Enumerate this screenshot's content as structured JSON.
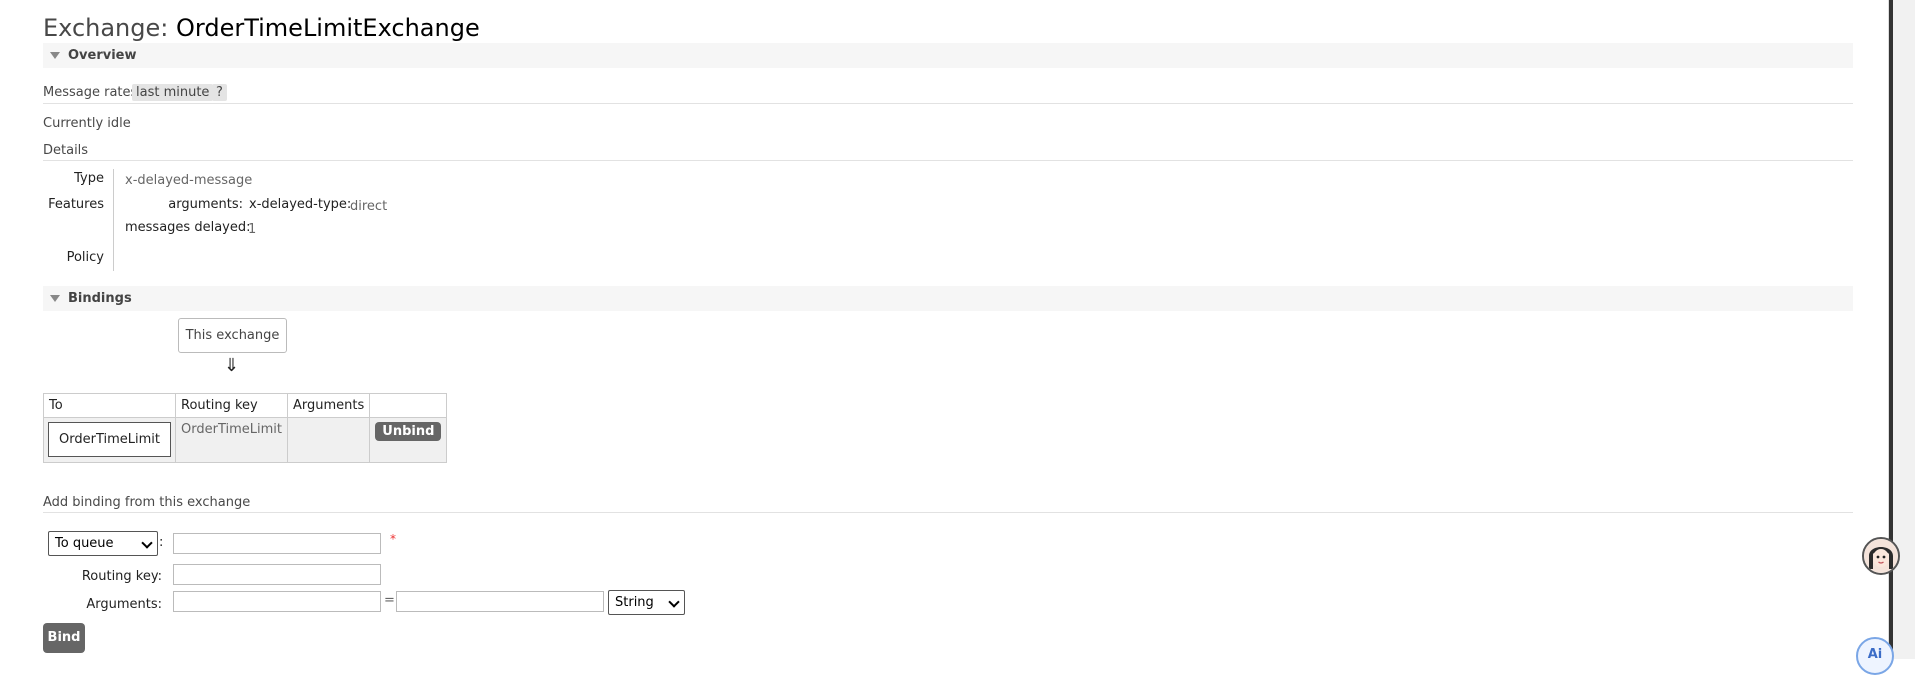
{
  "header": {
    "prefix": "Exchange:",
    "name": "OrderTimeLimitExchange"
  },
  "overview": {
    "section_title": "Overview",
    "message_rates_label": "Message rates",
    "rate_period": "last minute",
    "help": "?",
    "status": "Currently idle",
    "details_title": "Details",
    "type_label": "Type",
    "type_value": "x-delayed-message",
    "features_label": "Features",
    "arguments_label": "arguments:",
    "delayed_type_key": "x-delayed-type:",
    "delayed_type_value": "direct",
    "messages_delayed_label": "messages delayed:",
    "messages_delayed_value": "1",
    "policy_label": "Policy"
  },
  "bindings": {
    "section_title": "Bindings",
    "this_exchange": "This exchange",
    "arrow": "⇓",
    "columns": [
      "To",
      "Routing key",
      "Arguments",
      ""
    ],
    "rows": [
      {
        "to": "OrderTimeLimit",
        "routing_key": "OrderTimeLimit",
        "arguments": "",
        "action": "Unbind"
      }
    ]
  },
  "add_binding": {
    "title": "Add binding from this exchange",
    "destination_type": "To queue",
    "required_mark": "*",
    "routing_key_label": "Routing key:",
    "arguments_label": "Arguments:",
    "equals": "=",
    "arg_type": "String",
    "bind_label": "Bind"
  },
  "widgets": {
    "ai_label": "Ai",
    "avatar_icon": "avatar-icon"
  }
}
